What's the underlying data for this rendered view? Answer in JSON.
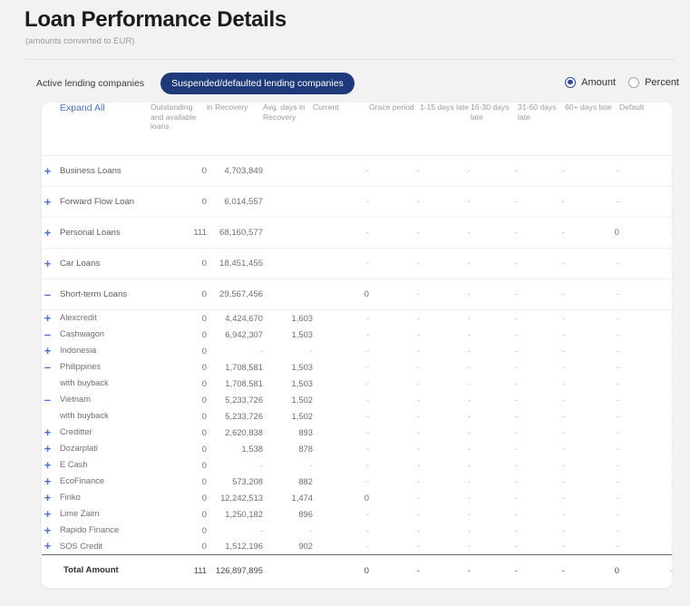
{
  "header": {
    "title": "Loan Performance Details",
    "subtitle": "(amounts converted to EUR)"
  },
  "tabs": [
    {
      "label": "Active lending companies",
      "active": false
    },
    {
      "label": "Suspended/defaulted lending companies",
      "active": true
    }
  ],
  "view_mode": {
    "options": [
      {
        "label": "Amount",
        "selected": true
      },
      {
        "label": "Percent",
        "selected": false
      }
    ]
  },
  "colors": {
    "accent_blue": "#4a73c4",
    "tab_active_bg": "#1e3a7b",
    "page_bg": "#f2f2f2",
    "card_bg": "#ffffff",
    "muted_text": "#9b9b9b"
  },
  "table": {
    "expand_all_label": "Expand All",
    "columns": [
      "Outstanding and available loans",
      "in Recovery",
      "Avg. days in Recovery",
      "Current",
      "Grace period",
      "1-15 days late",
      "16-30 days late",
      "31-60 days late",
      "60+ days late",
      "Default"
    ],
    "rows": [
      {
        "label": "Business Loans",
        "level": 0,
        "toggle": "plus",
        "values": [
          "0",
          "4,703,849",
          "",
          "-",
          "-",
          "-",
          "-",
          "-",
          "-",
          "-"
        ]
      },
      {
        "label": "Forward Flow Loan",
        "level": 0,
        "toggle": "plus",
        "values": [
          "0",
          "6,014,557",
          "",
          "-",
          "-",
          "-",
          "-",
          "-",
          "-",
          "-"
        ]
      },
      {
        "label": "Personal Loans",
        "level": 0,
        "toggle": "plus",
        "values": [
          "111",
          "68,160,577",
          "",
          "-",
          "-",
          "-",
          "-",
          "-",
          "0",
          "-"
        ]
      },
      {
        "label": "Car Loans",
        "level": 0,
        "toggle": "plus",
        "values": [
          "0",
          "18,451,455",
          "",
          "-",
          "-",
          "-",
          "-",
          "-",
          "-",
          "-"
        ]
      },
      {
        "label": "Short-term Loans",
        "level": 0,
        "toggle": "minus",
        "values": [
          "0",
          "29,567,456",
          "",
          "0",
          "-",
          "-",
          "-",
          "-",
          "-",
          "-"
        ]
      },
      {
        "label": "Alexcredit",
        "level": 1,
        "toggle": "plus",
        "values": [
          "0",
          "4,424,670",
          "1,603",
          "-",
          "-",
          "-",
          "-",
          "-",
          "-",
          "-"
        ]
      },
      {
        "label": "Cashwagon",
        "level": 1,
        "toggle": "minus",
        "values": [
          "0",
          "6,942,307",
          "1,503",
          "-",
          "-",
          "-",
          "-",
          "-",
          "-",
          "-"
        ]
      },
      {
        "label": "Indonesia",
        "level": 2,
        "toggle": "plus",
        "values": [
          "0",
          "-",
          "-",
          "-",
          "-",
          "-",
          "-",
          "-",
          "-",
          "-"
        ]
      },
      {
        "label": "Philippines",
        "level": 2,
        "toggle": "minus",
        "values": [
          "0",
          "1,708,581",
          "1,503",
          "-",
          "-",
          "-",
          "-",
          "-",
          "-",
          "-"
        ]
      },
      {
        "label": "with buyback",
        "level": 3,
        "toggle": "none",
        "values": [
          "0",
          "1,708,581",
          "1,503",
          "-",
          "-",
          "-",
          "-",
          "-",
          "-",
          "-"
        ]
      },
      {
        "label": "Vietnam",
        "level": 2,
        "toggle": "minus",
        "values": [
          "0",
          "5,233,726",
          "1,502",
          "-",
          "-",
          "-",
          "-",
          "-",
          "-",
          "-"
        ]
      },
      {
        "label": "with buyback",
        "level": 3,
        "toggle": "none",
        "values": [
          "0",
          "5,233,726",
          "1,502",
          "-",
          "-",
          "-",
          "-",
          "-",
          "-",
          "-"
        ]
      },
      {
        "label": "Creditter",
        "level": 1,
        "toggle": "plus",
        "values": [
          "0",
          "2,620,838",
          "893",
          "-",
          "-",
          "-",
          "-",
          "-",
          "-",
          "-"
        ]
      },
      {
        "label": "Dozarplati",
        "level": 1,
        "toggle": "plus",
        "values": [
          "0",
          "1,538",
          "878",
          "-",
          "-",
          "-",
          "-",
          "-",
          "-",
          "-"
        ]
      },
      {
        "label": "E Cash",
        "level": 1,
        "toggle": "plus",
        "values": [
          "0",
          "-",
          "-",
          "-",
          "-",
          "-",
          "-",
          "-",
          "-",
          "-"
        ]
      },
      {
        "label": "EcoFinance",
        "level": 1,
        "toggle": "plus",
        "values": [
          "0",
          "573,208",
          "882",
          "-",
          "-",
          "-",
          "-",
          "-",
          "-",
          "-"
        ]
      },
      {
        "label": "Finko",
        "level": 1,
        "toggle": "plus",
        "values": [
          "0",
          "12,242,513",
          "1,474",
          "0",
          "-",
          "-",
          "-",
          "-",
          "-",
          "-"
        ]
      },
      {
        "label": "Lime Zaim",
        "level": 1,
        "toggle": "plus",
        "values": [
          "0",
          "1,250,182",
          "896",
          "-",
          "-",
          "-",
          "-",
          "-",
          "-",
          "-"
        ]
      },
      {
        "label": "Rapido Finance",
        "level": 1,
        "toggle": "plus",
        "values": [
          "0",
          "-",
          "-",
          "-",
          "-",
          "-",
          "-",
          "-",
          "-",
          "-"
        ]
      },
      {
        "label": "SOS Credit",
        "level": 1,
        "toggle": "plus",
        "values": [
          "0",
          "1,512,196",
          "902",
          "-",
          "-",
          "-",
          "-",
          "-",
          "-",
          "-"
        ]
      }
    ],
    "total_row": {
      "label": "Total Amount",
      "values": [
        "111",
        "126,897,895",
        "",
        "0",
        "-",
        "-",
        "-",
        "-",
        "0",
        "-"
      ]
    }
  }
}
